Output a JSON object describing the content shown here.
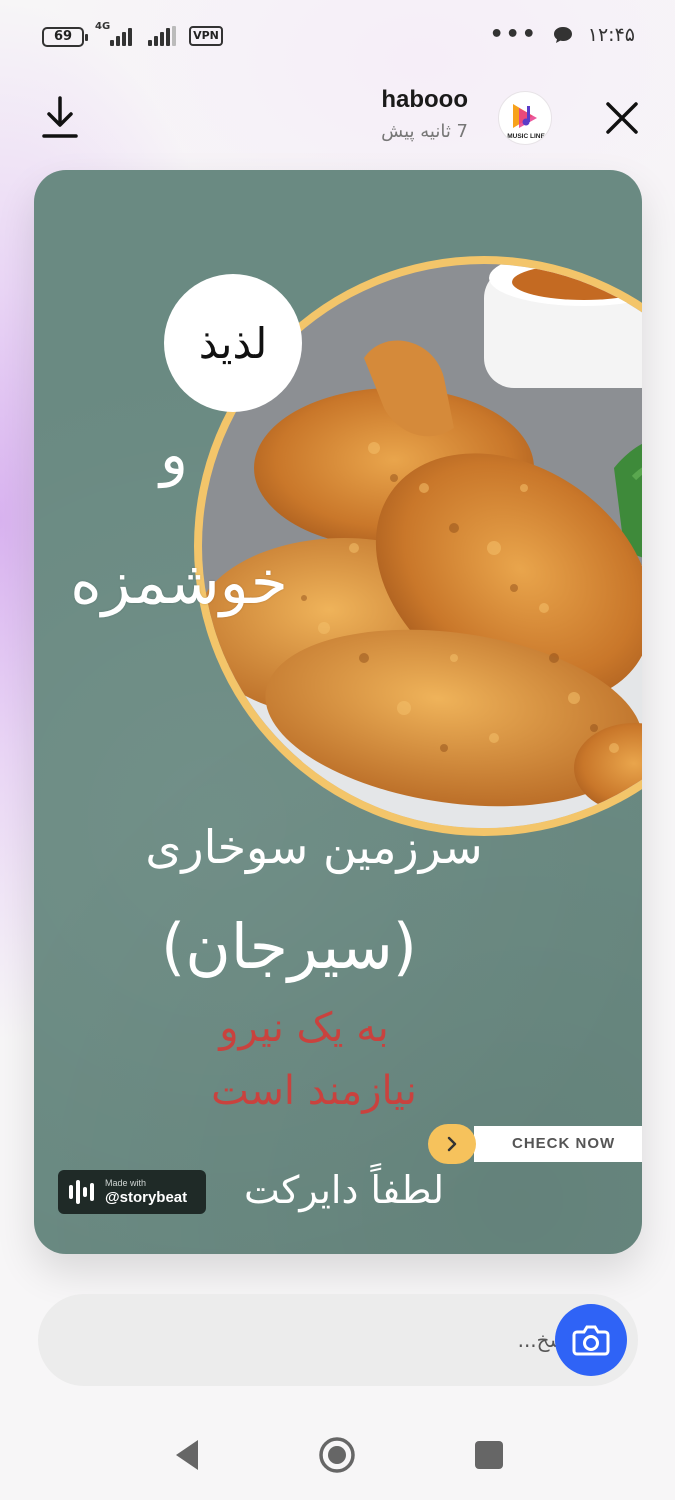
{
  "status_bar": {
    "battery_level": "69",
    "network_type": "4G",
    "vpn_label": "VPN",
    "more_dots": "•••",
    "time": "۱۲:۴۵"
  },
  "header": {
    "author_name": "habooo",
    "post_time": "7 ثانیه پیش",
    "avatar_logo_text": "MUSIC LINE"
  },
  "story": {
    "badge_word": "لذیذ",
    "and_word": "و",
    "tasty_word": "خوشمزه",
    "land_line": "سرزمین سوخاری",
    "city_line": "(سیرجان)",
    "need_line_1": "به یک نیرو",
    "need_line_2": "نیازمند است",
    "direct_line": "لطفاً دایرکت",
    "check_now_label": "CHECK NOW",
    "storybeat_made_with": "Made with",
    "storybeat_handle": "@storybeat",
    "colors": {
      "background": "#6a8a82",
      "accent_yellow": "#f6c25c",
      "red_text": "#c9423e"
    }
  },
  "reply": {
    "placeholder": "پاسخ..."
  },
  "icons": {
    "download": "download-icon",
    "close": "close-icon",
    "camera": "camera-icon",
    "nav_back": "back-triangle-icon",
    "nav_home": "home-circle-icon",
    "nav_recents": "recents-square-icon"
  },
  "accent_color": "#2f63f6"
}
